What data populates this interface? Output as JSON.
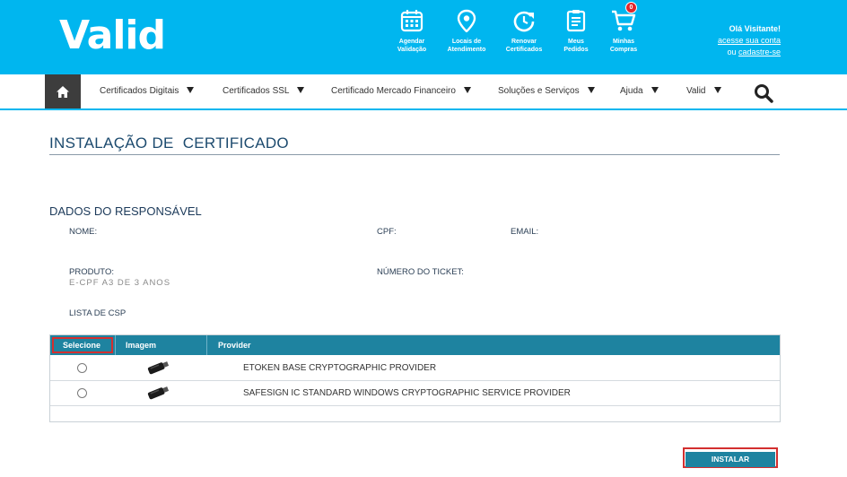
{
  "header": {
    "logo": "Valid",
    "quick_links": [
      {
        "line1": "Agendar",
        "line2": "Validação",
        "icon": "calendar-icon"
      },
      {
        "line1": "Locais de",
        "line2": "Atendimento",
        "icon": "location-pin-icon"
      },
      {
        "line1": "Renovar",
        "line2": "Certificados",
        "icon": "renew-icon"
      },
      {
        "line1": "Meus",
        "line2": "Pedidos",
        "icon": "orders-icon"
      },
      {
        "line1": "Minhas",
        "line2": "Compras",
        "icon": "cart-icon",
        "badge": "0"
      }
    ],
    "greeting": "Olá Visitante!",
    "login_link": "acesse sua conta",
    "or_text": "ou",
    "register_link": "cadastre-se"
  },
  "nav": {
    "items": [
      "Certificados Digitais",
      "Certificados SSL",
      "Certificado Mercado Financeiro",
      "Soluções e Serviços",
      "Ajuda",
      "Valid"
    ]
  },
  "page": {
    "title": "INSTALAÇÃO DE  CERTIFICADO",
    "section_title": "DADOS DO RESPONSÁVEL",
    "fields": {
      "nome_label": "NOME:",
      "cpf_label": "CPF:",
      "email_label": "EMAIL:",
      "produto_label": "PRODUTO:",
      "produto_value": "E-CPF A3 DE 3 ANOS",
      "ticket_label": "NÚMERO DO TICKET:",
      "csp_label": "LISTA DE CSP"
    },
    "table": {
      "headers": [
        "Selecione",
        "Imagem",
        "Provider"
      ],
      "rows": [
        {
          "provider": "ETOKEN BASE CRYPTOGRAPHIC PROVIDER",
          "icon": "usb-token-icon"
        },
        {
          "provider": "SAFESIGN IC STANDARD WINDOWS CRYPTOGRAPHIC SERVICE PROVIDER",
          "icon": "usb-token-icon"
        }
      ]
    },
    "install_label": "INSTALAR"
  },
  "colors": {
    "header_bg": "#00b6ef",
    "table_header": "#1e83a0",
    "highlight": "#d32f2f"
  }
}
